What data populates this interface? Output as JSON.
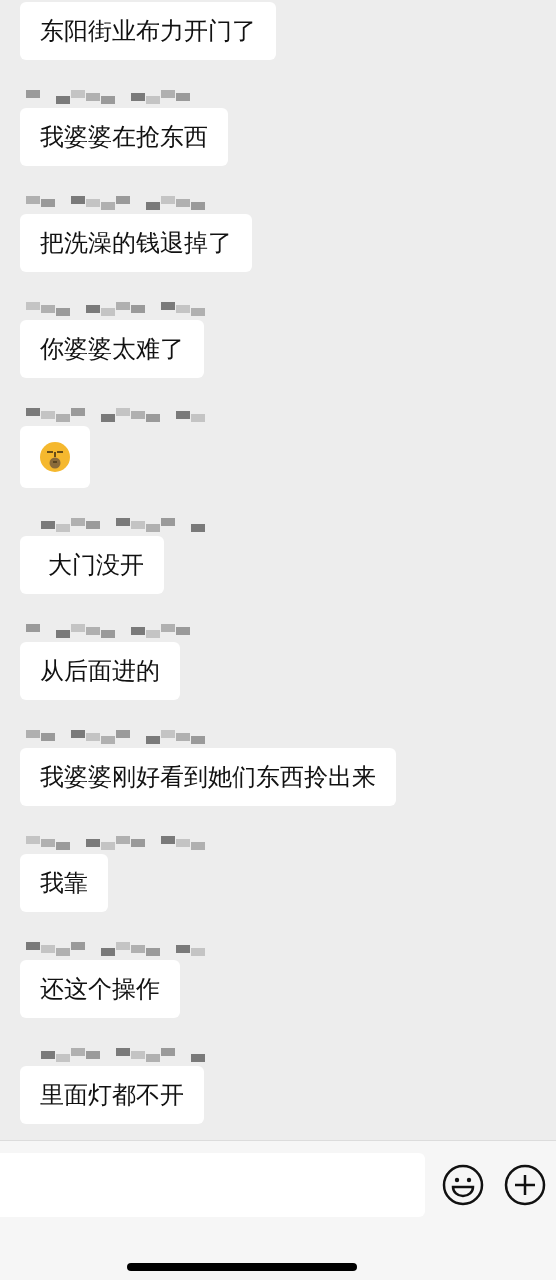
{
  "messages": [
    {
      "kind": "text",
      "sender_visible": false,
      "text": "东阳街业布力开门了"
    },
    {
      "kind": "text",
      "sender_visible": true,
      "text": "我婆婆在抢东西"
    },
    {
      "kind": "text",
      "sender_visible": true,
      "text": "把洗澡的钱退掉了"
    },
    {
      "kind": "text",
      "sender_visible": true,
      "text": "你婆婆太难了"
    },
    {
      "kind": "emoji",
      "sender_visible": true
    },
    {
      "kind": "text",
      "sender_visible": true,
      "text": " 大门没开"
    },
    {
      "kind": "text",
      "sender_visible": true,
      "text": "从后面进的"
    },
    {
      "kind": "text",
      "sender_visible": true,
      "text": "我婆婆刚好看到她们东西拎出来"
    },
    {
      "kind": "text",
      "sender_visible": true,
      "text": "我靠"
    },
    {
      "kind": "text",
      "sender_visible": true,
      "text": "还这个操作"
    },
    {
      "kind": "text",
      "sender_visible": true,
      "text": "里面灯都不开"
    }
  ]
}
